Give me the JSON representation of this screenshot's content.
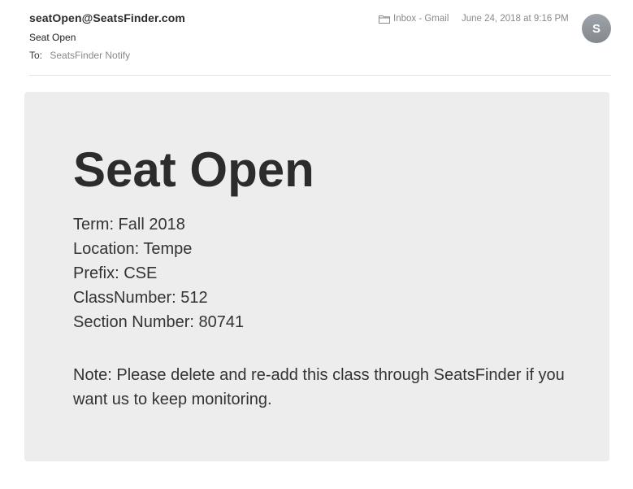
{
  "header": {
    "sender": "seatOpen@SeatsFinder.com",
    "subject": "Seat Open",
    "to_label": "To:",
    "to_value": "SeatsFinder Notify",
    "mailbox": "Inbox - Gmail",
    "mailbox_icon": "folder-icon",
    "date": "June 24, 2018 at 9:16 PM",
    "avatar_initial": "S"
  },
  "body": {
    "title": "Seat Open",
    "details": [
      "Term: Fall 2018",
      "Location: Tempe",
      "Prefix: CSE",
      "ClassNumber: 512",
      "Section Number: 80741"
    ],
    "note": "Note: Please delete and re-add this class through SeatsFinder if you want us to keep monitoring."
  },
  "colors": {
    "card_background": "#ededed",
    "muted_text": "#8a8a8a",
    "avatar_background": "#8e939a"
  }
}
